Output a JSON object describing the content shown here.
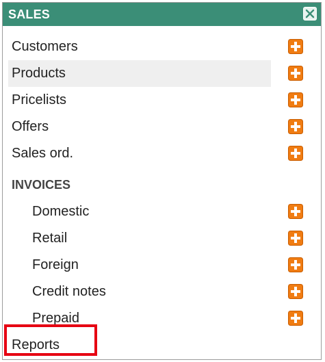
{
  "panel": {
    "title": "SALES",
    "close_icon": "close-icon"
  },
  "menu": {
    "items": [
      {
        "label": "Customers",
        "icon": "plus-icon"
      },
      {
        "label": "Products",
        "icon": "plus-icon",
        "state": "hovered"
      },
      {
        "label": "Pricelists",
        "icon": "plus-icon"
      },
      {
        "label": "Offers",
        "icon": "plus-icon"
      },
      {
        "label": "Sales ord.",
        "icon": "plus-icon"
      }
    ],
    "invoices": {
      "title": "INVOICES",
      "items": [
        {
          "label": "Domestic",
          "icon": "plus-icon"
        },
        {
          "label": "Retail",
          "icon": "plus-icon"
        },
        {
          "label": "Foreign",
          "icon": "plus-icon"
        },
        {
          "label": "Credit notes",
          "icon": "plus-icon"
        },
        {
          "label": "Prepaid",
          "icon": "plus-icon"
        }
      ]
    },
    "reports": {
      "label": "Reports",
      "state": "highlighted"
    }
  },
  "colors": {
    "header": "#3b8e77",
    "plus_icon": "#f07c12",
    "hover_row": "#efefef",
    "highlight": "#e60012"
  }
}
